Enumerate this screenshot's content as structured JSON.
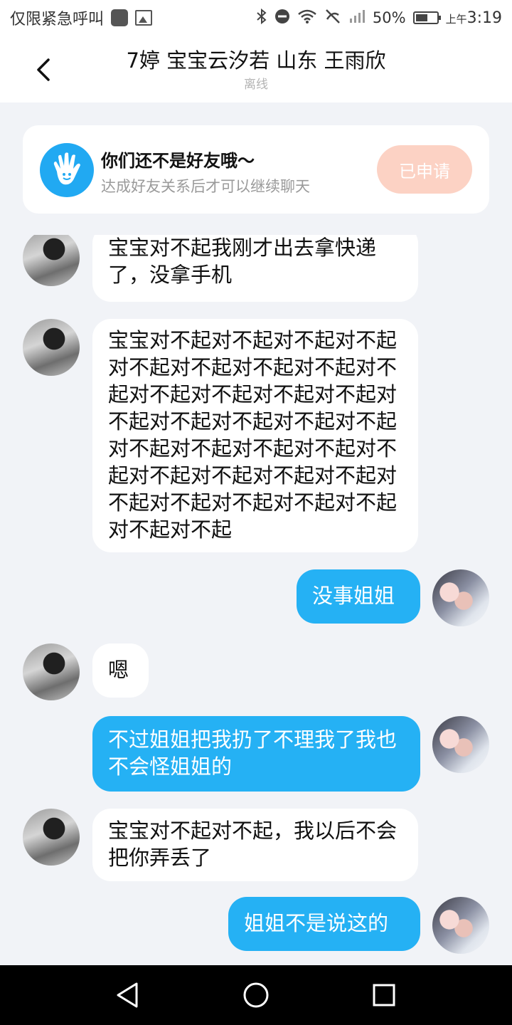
{
  "status_bar": {
    "left_text": "仅限紧急呼叫",
    "battery": "50%",
    "ampm": "上午",
    "time": "3:19"
  },
  "header": {
    "title": "7婷 宝宝云汐若 山东 王雨欣",
    "status": "离线"
  },
  "friend_card": {
    "title": "你们还不是好友哦～",
    "subtitle": "达成好友关系后才可以继续聊天",
    "button_label": "已申请"
  },
  "messages": [
    {
      "from": "other",
      "text": "宝宝对不起我刚才出去拿快递了，没拿手机"
    },
    {
      "from": "other",
      "text": "宝宝对不起对不起对不起对不起对不起对不起对不起对不起对不起对不起对不起对不起对不起对不起对不起对不起对不起对不起对不起对不起对不起对不起对不起对不起对不起对不起对不起对不起对不起对不起对不起对不起对不起对不起"
    },
    {
      "from": "self",
      "text": "没事姐姐"
    },
    {
      "from": "other",
      "text": "嗯"
    },
    {
      "from": "self",
      "text": "不过姐姐把我扔了不理我了我也不会怪姐姐的"
    },
    {
      "from": "other",
      "text": "宝宝对不起对不起，我以后不会把你弄丢了"
    },
    {
      "from": "self",
      "text": "姐姐不是说这的"
    }
  ],
  "colors": {
    "accent": "#25b1f4",
    "applied_button": "#fcd2c4",
    "background": "#f1f3f7"
  },
  "icons": {
    "back": "chevron-left-icon",
    "card": "waving-hand-icon",
    "nav": [
      "back-triangle-icon",
      "home-circle-icon",
      "recents-square-icon"
    ]
  }
}
